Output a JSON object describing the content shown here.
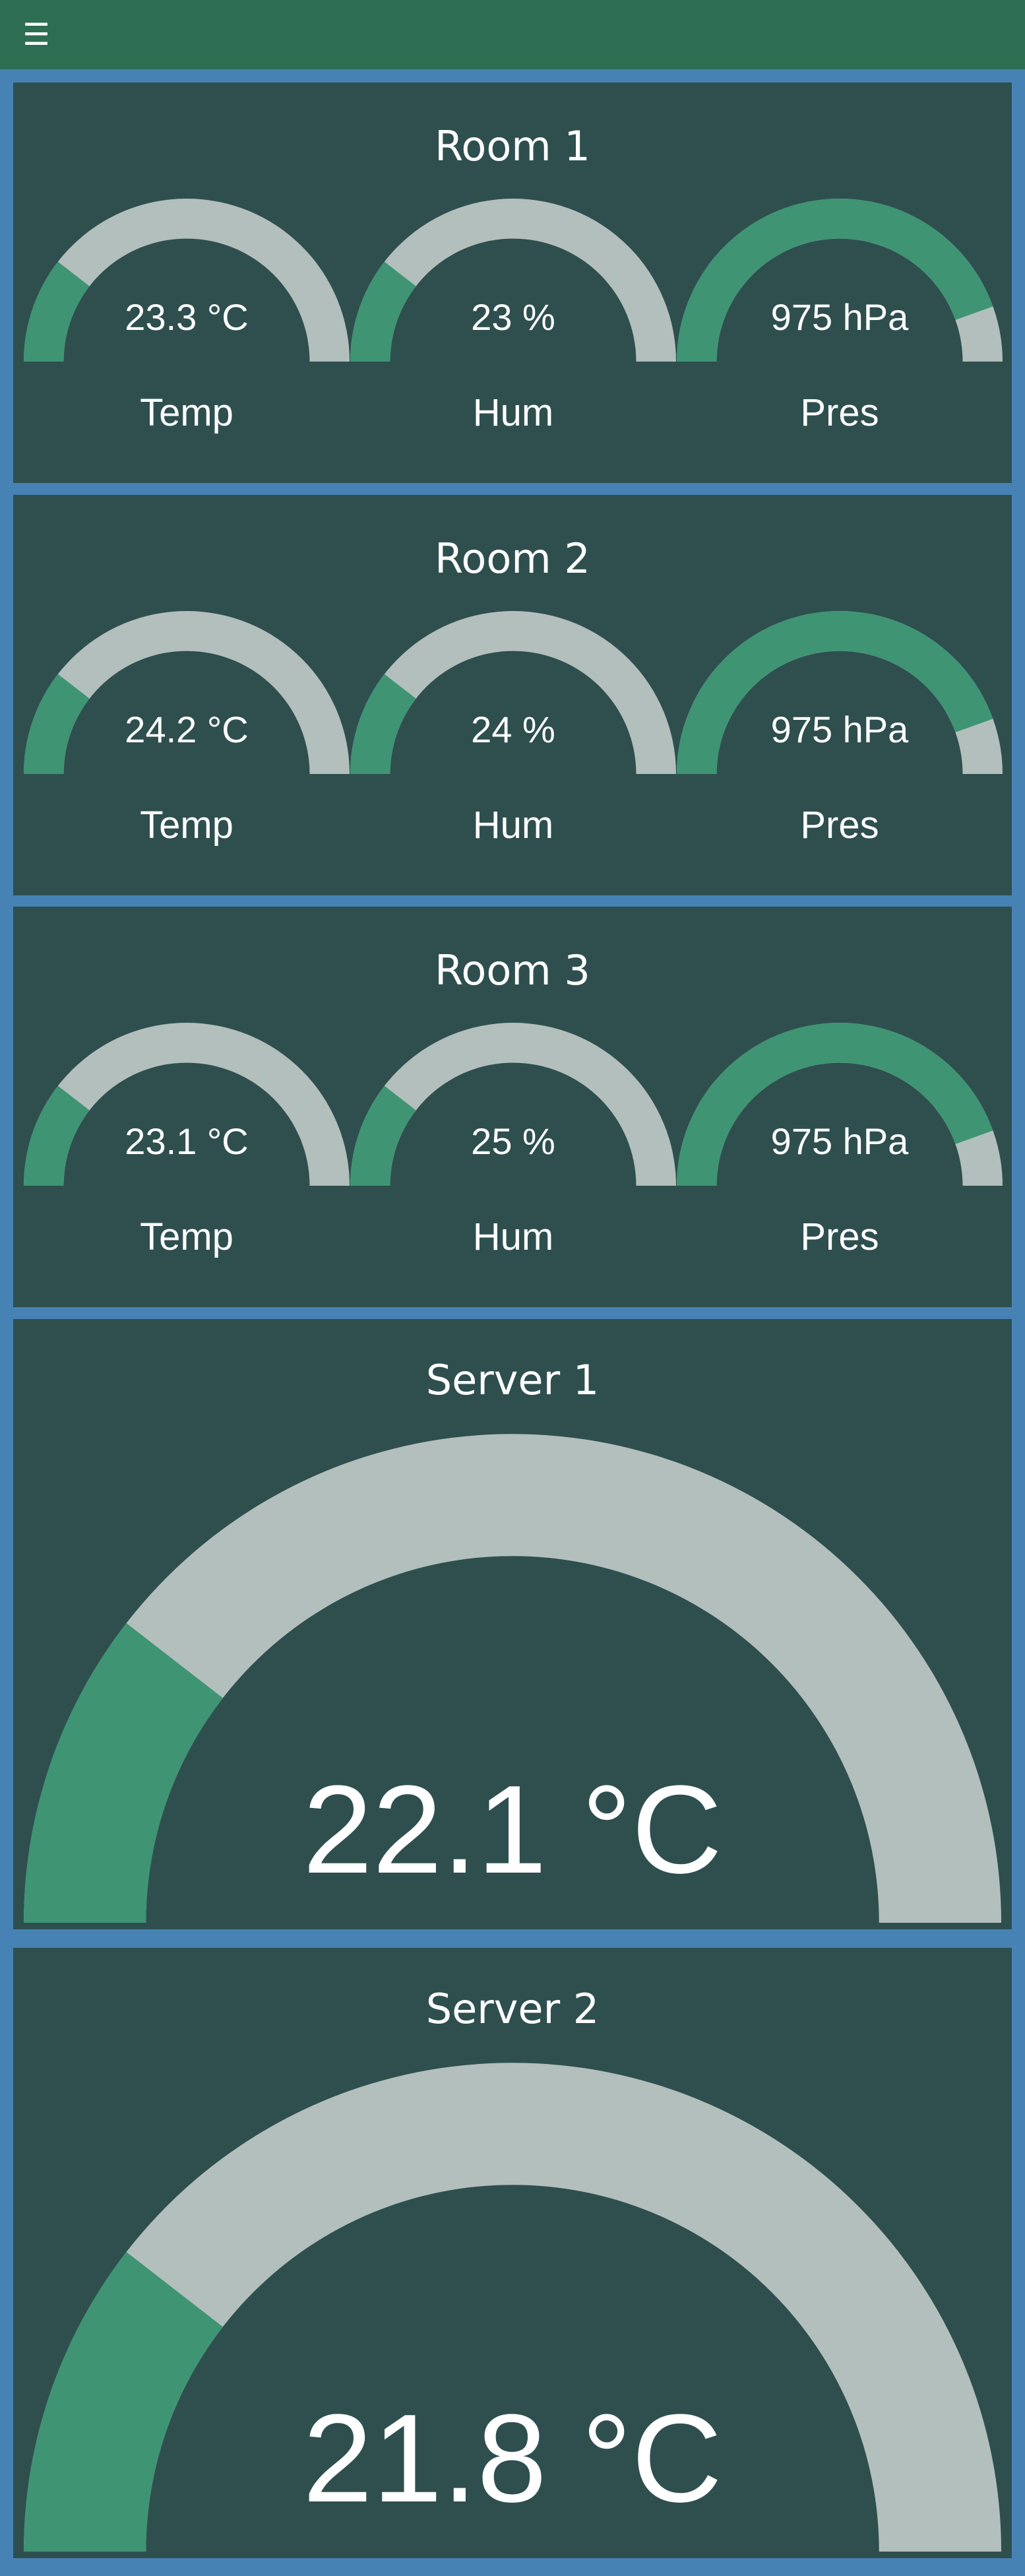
{
  "menu": {
    "icon": "hamburger-menu-icon",
    "glyph": "☰"
  },
  "colors": {
    "topbar": "#2d6e52",
    "background": "#4682b4",
    "card": "#2f4f4f",
    "gauge_fill": "#3f9473",
    "gauge_track": "#b3bfbc",
    "text": "#ffffff"
  },
  "rooms": [
    {
      "title": "Room 1",
      "gauges": [
        {
          "value_text": "23.3 °C",
          "label": "Temp",
          "level": 0.21
        },
        {
          "value_text": "23 %",
          "label": "Hum",
          "level": 0.21
        },
        {
          "value_text": "975 hPa",
          "label": "Pres",
          "level": 0.89
        }
      ]
    },
    {
      "title": "Room 2",
      "gauges": [
        {
          "value_text": "24.2 °C",
          "label": "Temp",
          "level": 0.21
        },
        {
          "value_text": "24 %",
          "label": "Hum",
          "level": 0.21
        },
        {
          "value_text": "975 hPa",
          "label": "Pres",
          "level": 0.89
        }
      ]
    },
    {
      "title": "Room 3",
      "gauges": [
        {
          "value_text": "23.1 °C",
          "label": "Temp",
          "level": 0.21
        },
        {
          "value_text": "25 %",
          "label": "Hum",
          "level": 0.21
        },
        {
          "value_text": "975 hPa",
          "label": "Pres",
          "level": 0.89
        }
      ]
    }
  ],
  "servers": [
    {
      "title": "Server 1",
      "value_text": "22.1 °C",
      "level": 0.21
    },
    {
      "title": "Server 2",
      "value_text": "21.8 °C",
      "level": 0.21
    }
  ]
}
